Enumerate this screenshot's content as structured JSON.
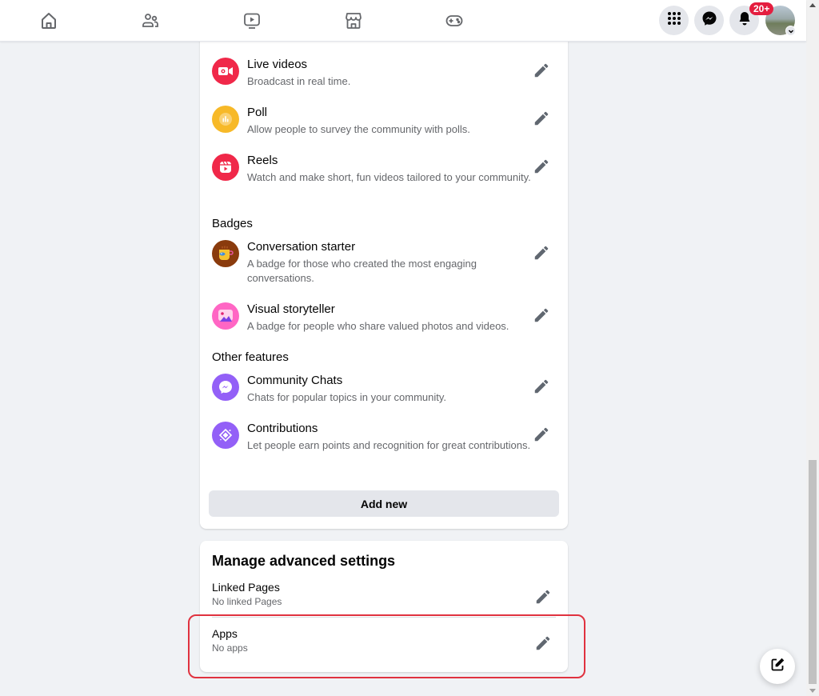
{
  "topbar": {
    "nav": [
      {
        "name": "home",
        "icon": "home-icon"
      },
      {
        "name": "friends",
        "icon": "friends-icon"
      },
      {
        "name": "watch",
        "icon": "video-icon"
      },
      {
        "name": "marketplace",
        "icon": "marketplace-icon"
      },
      {
        "name": "gaming",
        "icon": "gaming-icon"
      }
    ],
    "menu_icon": "grid-menu-icon",
    "messenger_icon": "messenger-icon",
    "notifications_icon": "bell-icon",
    "notification_badge": "20+",
    "avatar_icon": "profile-avatar"
  },
  "features": {
    "items": [
      {
        "title": "Live videos",
        "description": "Broadcast in real time.",
        "icon": "live-video-icon",
        "color": "#f02849"
      },
      {
        "title": "Poll",
        "description": "Allow people to survey the community with polls.",
        "icon": "poll-icon",
        "color": "#f7b928"
      },
      {
        "title": "Reels",
        "description": "Watch and make short, fun videos tailored to your community.",
        "icon": "reels-icon",
        "color": "#f02849"
      }
    ],
    "badges_label": "Badges",
    "badges": [
      {
        "title": "Conversation starter",
        "description": "A badge for those who created the most engaging conversations.",
        "icon": "coffee-cup-icon"
      },
      {
        "title": "Visual storyteller",
        "description": "A badge for people who share valued photos and videos.",
        "icon": "photo-icon"
      }
    ],
    "other_label": "Other features",
    "other": [
      {
        "title": "Community Chats",
        "description": "Chats for popular topics in your community.",
        "icon": "messenger-icon",
        "color": "#9360f7"
      },
      {
        "title": "Contributions",
        "description": "Let people earn points and recognition for great contributions.",
        "icon": "contributions-icon",
        "color": "#9360f7"
      }
    ],
    "add_new_label": "Add new"
  },
  "advanced": {
    "title": "Manage advanced settings",
    "rows": [
      {
        "title": "Linked Pages",
        "description": "No linked Pages"
      },
      {
        "title": "Apps",
        "description": "No apps"
      }
    ]
  },
  "fab": {
    "icon": "compose-icon"
  },
  "colors": {
    "accent_red": "#e41e3f",
    "highlight": "#e0323f",
    "icon_gray": "#65676b"
  }
}
